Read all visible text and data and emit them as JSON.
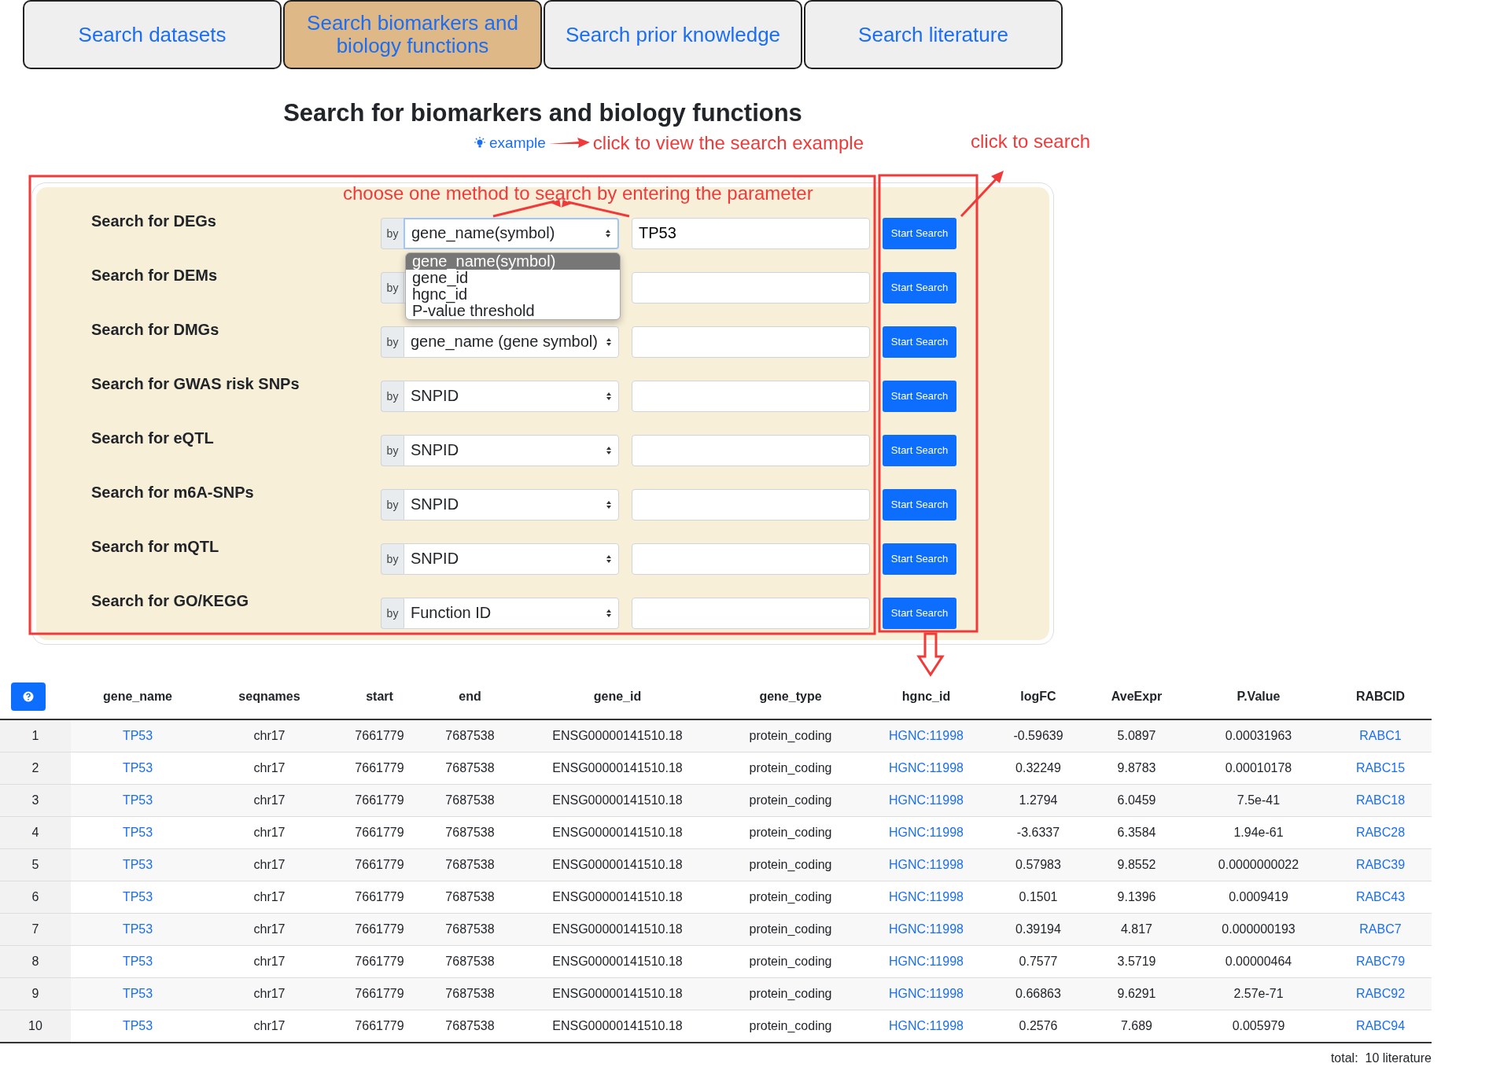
{
  "tabs": [
    {
      "label": "Search datasets",
      "selected": false
    },
    {
      "label": "Search biomarkers and biology functions",
      "selected": true
    },
    {
      "label": "Search prior knowledge",
      "selected": false
    },
    {
      "label": "Search literature",
      "selected": false
    }
  ],
  "title": "Search for biomarkers and biology functions",
  "example_link": "example",
  "annotations": {
    "example_hint": "click to view the search example",
    "search_hint": "click to search",
    "method_hint": "choose one method to search by entering the parameter"
  },
  "search_rows": [
    {
      "label": "Search for DEGs",
      "by": "by",
      "method": "gene_name(symbol)",
      "value": "TP53",
      "button": "Start Search"
    },
    {
      "label": "Search for DEMs",
      "by": "by",
      "button": "Start Search"
    },
    {
      "label": "Search for DMGs",
      "by": "by",
      "method": "gene_name (gene symbol)",
      "button": "Start Search"
    },
    {
      "label": "Search for GWAS risk SNPs",
      "by": "by",
      "method": "SNPID",
      "button": "Start Search"
    },
    {
      "label": "Search for eQTL",
      "by": "by",
      "method": "SNPID",
      "button": "Start Search"
    },
    {
      "label": "Search for m6A-SNPs",
      "by": "by",
      "method": "SNPID",
      "button": "Start Search"
    },
    {
      "label": "Search for mQTL",
      "by": "by",
      "method": "SNPID",
      "button": "Start Search"
    },
    {
      "label": "Search for GO/KEGG",
      "by": "by",
      "method": "Function ID",
      "button": "Start Search"
    }
  ],
  "dropdown": [
    {
      "label": "gene_name(symbol)",
      "selected": true
    },
    {
      "label": "gene_id",
      "selected": false
    },
    {
      "label": "hgnc_id",
      "selected": false
    },
    {
      "label": "P-value threshold",
      "selected": false
    }
  ],
  "table": {
    "columns": [
      "",
      "gene_name",
      "seqnames",
      "start",
      "end",
      "gene_id",
      "gene_type",
      "hgnc_id",
      "logFC",
      "AveExpr",
      "P.Value",
      "RABCID"
    ],
    "rows": [
      [
        "1",
        "TP53",
        "chr17",
        "7661779",
        "7687538",
        "ENSG00000141510.18",
        "protein_coding",
        "HGNC:11998",
        "-0.59639",
        "5.0897",
        "0.00031963",
        "RABC1"
      ],
      [
        "2",
        "TP53",
        "chr17",
        "7661779",
        "7687538",
        "ENSG00000141510.18",
        "protein_coding",
        "HGNC:11998",
        "0.32249",
        "9.8783",
        "0.00010178",
        "RABC15"
      ],
      [
        "3",
        "TP53",
        "chr17",
        "7661779",
        "7687538",
        "ENSG00000141510.18",
        "protein_coding",
        "HGNC:11998",
        "1.2794",
        "6.0459",
        "7.5e-41",
        "RABC18"
      ],
      [
        "4",
        "TP53",
        "chr17",
        "7661779",
        "7687538",
        "ENSG00000141510.18",
        "protein_coding",
        "HGNC:11998",
        "-3.6337",
        "6.3584",
        "1.94e-61",
        "RABC28"
      ],
      [
        "5",
        "TP53",
        "chr17",
        "7661779",
        "7687538",
        "ENSG00000141510.18",
        "protein_coding",
        "HGNC:11998",
        "0.57983",
        "9.8552",
        "0.0000000022",
        "RABC39"
      ],
      [
        "6",
        "TP53",
        "chr17",
        "7661779",
        "7687538",
        "ENSG00000141510.18",
        "protein_coding",
        "HGNC:11998",
        "0.1501",
        "9.1396",
        "0.0009419",
        "RABC43"
      ],
      [
        "7",
        "TP53",
        "chr17",
        "7661779",
        "7687538",
        "ENSG00000141510.18",
        "protein_coding",
        "HGNC:11998",
        "0.39194",
        "4.817",
        "0.000000193",
        "RABC7"
      ],
      [
        "8",
        "TP53",
        "chr17",
        "7661779",
        "7687538",
        "ENSG00000141510.18",
        "protein_coding",
        "HGNC:11998",
        "0.7577",
        "3.5719",
        "0.00000464",
        "RABC79"
      ],
      [
        "9",
        "TP53",
        "chr17",
        "7661779",
        "7687538",
        "ENSG00000141510.18",
        "protein_coding",
        "HGNC:11998",
        "0.66863",
        "9.6291",
        "2.57e-71",
        "RABC92"
      ],
      [
        "10",
        "TP53",
        "chr17",
        "7661779",
        "7687538",
        "ENSG00000141510.18",
        "protein_coding",
        "HGNC:11998",
        "0.2576",
        "7.689",
        "0.005979",
        "RABC94"
      ]
    ],
    "total": "total:  10 literature"
  }
}
